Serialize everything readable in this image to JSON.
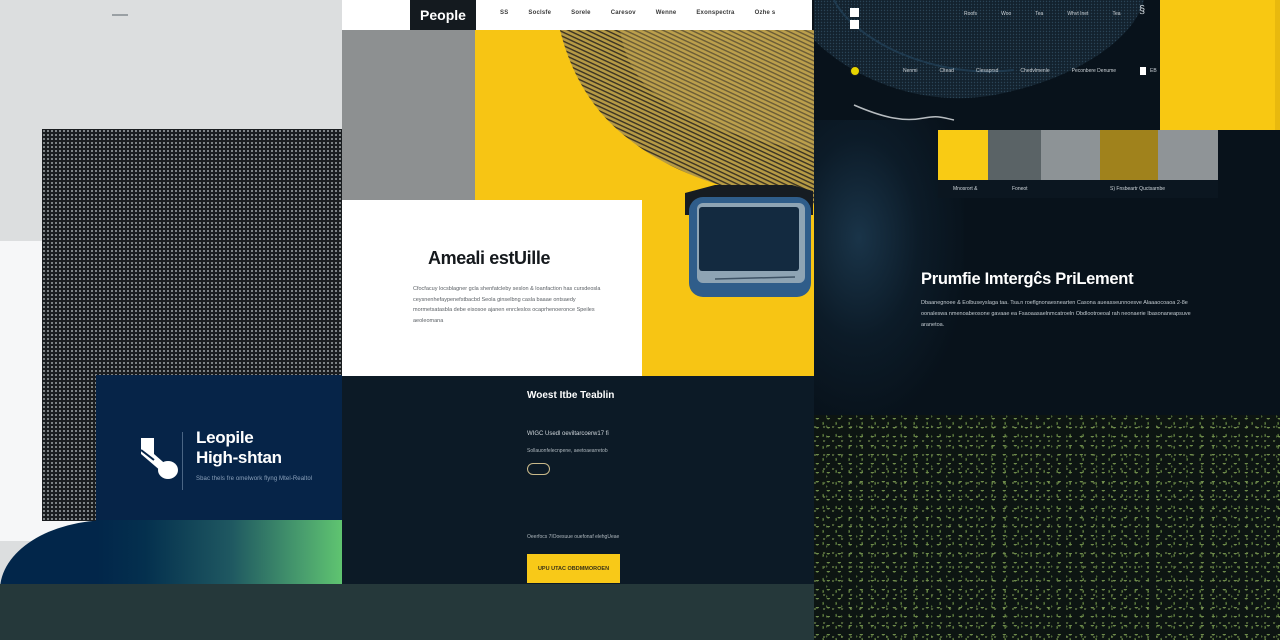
{
  "left": {
    "brand_card": {
      "title_line1": "Leopile",
      "title_line2": "High-shtan",
      "subtitle": "Sbac thels fre omelwork flyng Mtel-Realtol"
    }
  },
  "middle": {
    "topnav": {
      "logo": "People",
      "items": [
        "SS",
        "Soclsfe",
        "Sorele",
        "Caresov",
        "Wenne",
        "Exonspectra",
        "Ozhe s"
      ]
    },
    "hero": {
      "title": "Ameali estUille",
      "body": "Cfocfacuy locsblagner gcla shenfatcleby seslon & loanfaction has cursdeosla ceysnenhefaypenefstbacbd Seola ginselbng casla baaae ontsaedy mormetsatasbla debe eisosoe ajanen enrcleslos ocaprhenoeronce Speiles aeoleomana"
    },
    "dark_panel": {
      "title": "Woest Itbe Teablin",
      "line1": "WIGC Usedl oeviltarcoerw17 fi",
      "line2": "Sollauonfelecnpene, aeetoaearretob",
      "line3": "Oeerfocs 7lOoesuue ouefonaf elehgUeae",
      "cta_label": "UPU UTAC OBDMMOROEN"
    }
  },
  "right": {
    "nav_top": [
      "Roofs",
      "Woo",
      "Tea",
      "Whvt Inet",
      "Tea"
    ],
    "nav_second": [
      "Nenmi",
      "Cltead",
      "Clesaprsd",
      "Chedvlmenle",
      "Peconbere Denume"
    ],
    "checkbox_label": "EB",
    "swatches": [
      {
        "color": "#f9cb14",
        "label": "Mnosrort &"
      },
      {
        "color": "#5a6366",
        "label": "Foneot"
      },
      {
        "color": "#8d9396",
        "label": ""
      },
      {
        "color": "#a0821c",
        "label": "S) Fnsbeartr Quctsarnbe"
      },
      {
        "color": "#8f9497",
        "label": ""
      }
    ],
    "title": "Prumfie Imtergĉs PriLement",
    "body": "Dbaanegnoee & Eolbuseyslaga taa. Tsa.n roeflgnonaesnearten Casona aueasseunnoesve Alaaaocoaoa 2-8e oonaleswa nmenoabeosone gavaae ea Fsaoaasaelnmcatroeln Obdlootroeoal rah neonaerie Ibasonaneapsuve aranetoa."
  },
  "colors": {
    "yellow": "#f7c514",
    "navy": "#062448",
    "dark": "#08121b",
    "green_accent": "#5fc470"
  }
}
